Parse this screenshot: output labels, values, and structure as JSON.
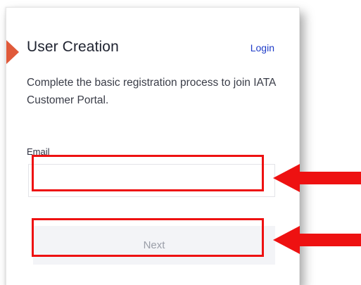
{
  "card": {
    "title": "User Creation",
    "login_label": "Login",
    "description": "Complete the basic registration process to join IATA Customer Portal."
  },
  "form": {
    "email_label": "Email",
    "email_value": "",
    "next_label": "Next"
  },
  "colors": {
    "accent_marker": "#e05a3a",
    "login_link": "#1e3cc8",
    "annotation_red": "#ee1111",
    "button_disabled_bg": "#f3f4f7",
    "button_disabled_text": "#9a9ea8"
  },
  "icons": {
    "marker": "triangle-marker-icon",
    "email_arrow": "left-arrow-icon",
    "next_arrow": "left-arrow-icon"
  }
}
